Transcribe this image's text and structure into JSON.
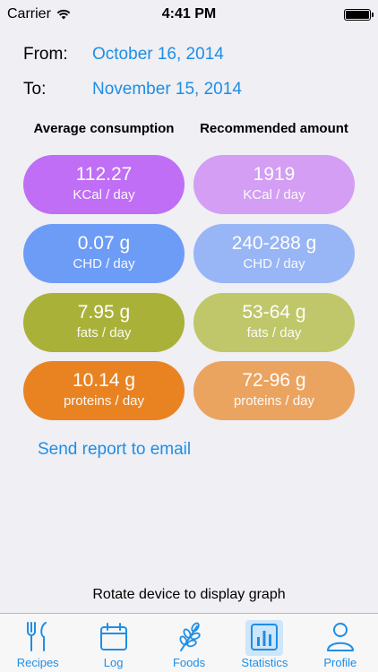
{
  "status": {
    "carrier": "Carrier",
    "time": "4:41 PM"
  },
  "period": {
    "from_label": "From:",
    "from_value": "October 16, 2014",
    "to_label": "To:",
    "to_value": "November 15, 2014"
  },
  "headers": {
    "average": "Average consumption",
    "recommended": "Recommended amount"
  },
  "rows": [
    {
      "avg_value": "112.27",
      "rec_value": "1919",
      "unit": "KCal / day",
      "avg_color": "#bf6ef5",
      "rec_color": "#d39ef3"
    },
    {
      "avg_value": "0.07 g",
      "rec_value": "240-288 g",
      "unit": "CHD / day",
      "avg_color": "#6d9cf7",
      "rec_color": "#98b5f5"
    },
    {
      "avg_value": "7.95 g",
      "rec_value": "53-64 g",
      "unit": "fats / day",
      "avg_color": "#a9b139",
      "rec_color": "#bfc76a"
    },
    {
      "avg_value": "10.14 g",
      "rec_value": "72-96 g",
      "unit": "proteins / day",
      "avg_color": "#e98322",
      "rec_color": "#eba460"
    }
  ],
  "actions": {
    "send_report": "Send report to email"
  },
  "hint": "Rotate device to display graph",
  "tabs": [
    {
      "label": "Recipes",
      "icon": "fork-knife-icon"
    },
    {
      "label": "Log",
      "icon": "calendar-icon"
    },
    {
      "label": "Foods",
      "icon": "wheat-icon"
    },
    {
      "label": "Statistics",
      "icon": "bar-chart-icon",
      "active": true
    },
    {
      "label": "Profile",
      "icon": "person-icon"
    }
  ],
  "colors": {
    "accent": "#1e8ee6"
  }
}
